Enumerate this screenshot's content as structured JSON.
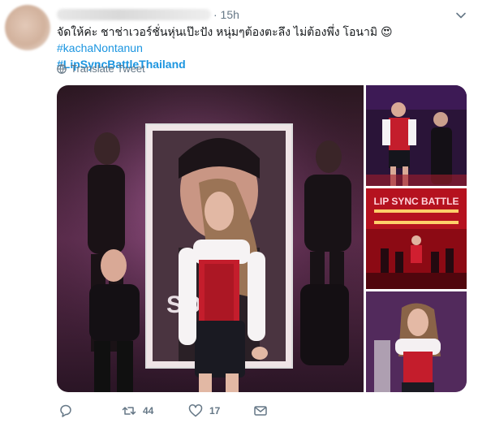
{
  "tweet": {
    "timestamp": "· 15h",
    "text_main": "จัดให้ค่ะ ชาช่าเวอร์ชั่นหุ่นเป๊ะปัง หนุ่มๆต้องตะลึง ไม่ต้องพึ่ง โอนามิ 😍 ",
    "hashtag1": "#kachaNontanun",
    "hashtag2": "#LipSyncBattleThailand",
    "translate_label": "Translate Tweet"
  },
  "media": {
    "poster_text": "SO",
    "thumb2_sign": "LIP SYNC BATTLE"
  },
  "actions": {
    "retweets": "44",
    "likes": "17"
  },
  "colors": {
    "link": "#1b95e0",
    "meta": "#657786"
  }
}
